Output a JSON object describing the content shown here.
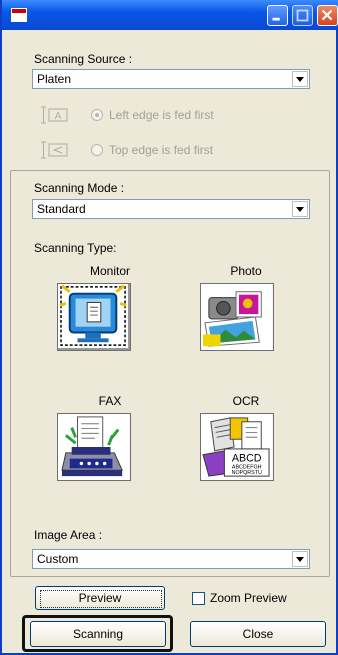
{
  "window": {
    "title": ""
  },
  "source": {
    "label": "Scanning Source :",
    "value": "Platen",
    "left_edge_label": "Left edge is fed first",
    "top_edge_label": "Top edge is fed first"
  },
  "mode": {
    "label": "Scanning Mode :",
    "value": "Standard"
  },
  "type": {
    "label": "Scanning Type:",
    "options": [
      {
        "label": "Monitor",
        "icon": "monitor-icon"
      },
      {
        "label": "Photo",
        "icon": "photo-icon"
      },
      {
        "label": "FAX",
        "icon": "fax-icon"
      },
      {
        "label": "OCR",
        "icon": "ocr-icon"
      }
    ],
    "ocr_text": [
      "ABCD",
      "ABCDEFGH",
      "NOPQRSTU"
    ]
  },
  "area": {
    "label": "Image Area :",
    "value": "Custom"
  },
  "buttons": {
    "preview": "Preview",
    "zoom_preview": "Zoom Preview",
    "scanning": "Scanning",
    "close": "Close"
  },
  "colors": {
    "titlebar": "#0a57e6",
    "highlight_border": "#111111"
  }
}
